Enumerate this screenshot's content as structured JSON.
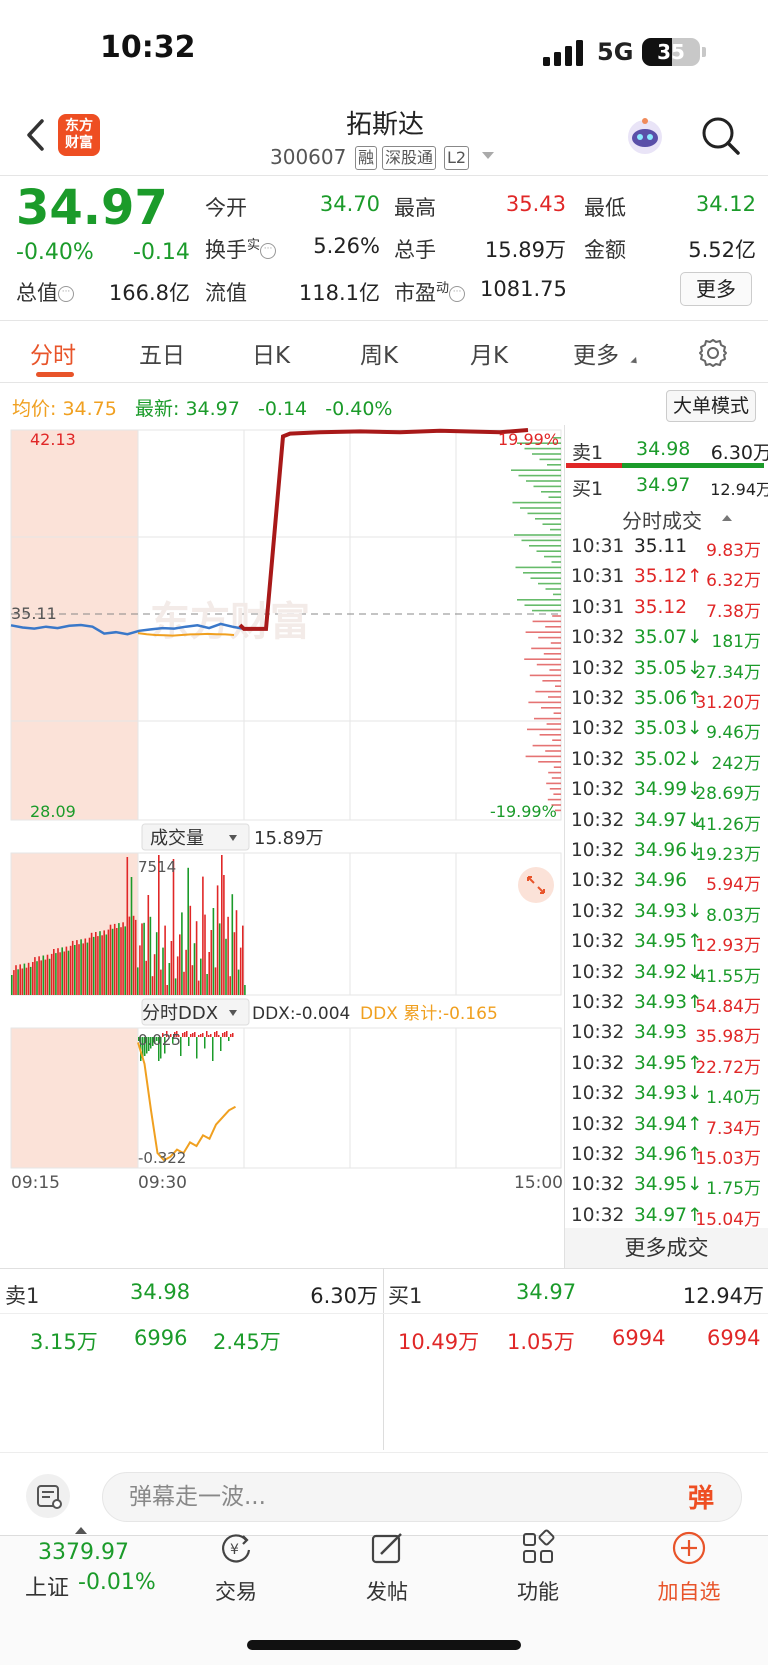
{
  "status_bar": {
    "time": "10:32",
    "network": "5G",
    "battery": "35"
  },
  "header": {
    "logo_line1": "东方",
    "logo_line2": "财富",
    "stock_name": "拓斯达",
    "stock_code": "300607",
    "tags": [
      "融",
      "深股通",
      "L2"
    ]
  },
  "quote": {
    "last_price": "34.97",
    "change_pct": "-0.40%",
    "change_abs": "-0.14",
    "open_label": "今开",
    "open": "34.70",
    "high_label": "最高",
    "high": "35.43",
    "low_label": "最低",
    "low": "34.12",
    "turnover_label": "换手",
    "turnover_sup": "实",
    "turnover": "5.26%",
    "volume_label": "总手",
    "volume": "15.89万",
    "amount_label": "金额",
    "amount": "5.52亿",
    "total_cap_label": "总值",
    "total_cap": "166.8亿",
    "float_cap_label": "流值",
    "float_cap": "118.1亿",
    "pe_label": "市盈",
    "pe_sup": "动",
    "pe": "1081.75",
    "more_label": "更多"
  },
  "tabs": [
    "分时",
    "五日",
    "日K",
    "周K",
    "月K",
    "更多"
  ],
  "chart_info": {
    "avg_label": "均价:",
    "avg_value": "34.75",
    "latest_label": "最新:",
    "latest_value": "34.97",
    "latest_chg": "-0.14",
    "latest_pct": "-0.40%",
    "big_order_label": "大单模式"
  },
  "chart_labels": {
    "price_top": "42.13",
    "price_bottom": "28.09",
    "price_ref": "35.11",
    "pct_top": "19.99%",
    "pct_bottom": "-19.99%",
    "watermark": "东方财富",
    "volume_selector": "成交量",
    "volume_total": "15.89万",
    "volume_max": "7514",
    "ddx_selector": "分时DDX",
    "ddx_value": "DDX:-0.004",
    "ddx_cum": "DDX 累计:-0.165",
    "ddx_top": "0.025",
    "ddx_bottom": "-0.322",
    "time_start": "09:15",
    "time_open": "09:30",
    "time_end": "15:00"
  },
  "chart_data": {
    "type": "line",
    "title": "",
    "price_axis": [
      28.09,
      42.13
    ],
    "reference_price": 35.11,
    "pct_axis": [
      "-19.99%",
      "19.99%"
    ],
    "x_ticks": [
      "09:15",
      "09:30",
      "15:00"
    ],
    "series": [
      {
        "name": "最新",
        "color": "#3a78c9",
        "values": [
          35.1,
          35.02,
          34.98,
          35.05,
          35.0,
          35.08,
          35.11,
          35.05,
          34.8,
          34.85,
          34.78,
          34.9,
          34.95,
          35.0,
          34.98,
          35.05,
          35.1,
          35.0,
          35.15,
          35.05,
          34.97
        ]
      },
      {
        "name": "均价",
        "color": "#f0a020",
        "values": [
          34.82,
          34.78,
          34.75,
          34.74,
          34.73,
          34.75,
          34.77,
          34.78,
          34.79,
          34.78,
          34.77,
          34.75
        ]
      },
      {
        "name": "",
        "color": "#a81919",
        "values": [
          35.11,
          34.97,
          34.97,
          41.9,
          42.0,
          42.05,
          42.08,
          42.05,
          42.1,
          42.05,
          42.13
        ]
      }
    ],
    "volume": {
      "max": 7514,
      "total": "15.89万"
    },
    "ddx": {
      "range": [
        -0.322,
        0.025
      ],
      "latest": -0.004,
      "cumulative": -0.165
    }
  },
  "order_book": {
    "sell1_label": "卖1",
    "sell1_price": "34.98",
    "sell1_vol": "6.30万",
    "buy1_label": "买1",
    "buy1_price": "34.97",
    "buy1_vol": "12.94万"
  },
  "trades_title": "分时成交",
  "trades": [
    {
      "time": "10:31",
      "price": "35.11",
      "price_color": "#222222",
      "arrow": "",
      "vol": "9.83万",
      "vol_color": "#e02727"
    },
    {
      "time": "10:31",
      "price": "35.12",
      "price_color": "#e02727",
      "arrow": "↑",
      "vol": "6.32万",
      "vol_color": "#e02727"
    },
    {
      "time": "10:31",
      "price": "35.12",
      "price_color": "#e02727",
      "arrow": "",
      "vol": "7.38万",
      "vol_color": "#e02727"
    },
    {
      "time": "10:32",
      "price": "35.07",
      "price_color": "#1b9b2a",
      "arrow": "↓",
      "vol": "181万",
      "vol_color": "#1b9b2a"
    },
    {
      "time": "10:32",
      "price": "35.05",
      "price_color": "#1b9b2a",
      "arrow": "↓",
      "vol": "27.34万",
      "vol_color": "#1b9b2a"
    },
    {
      "time": "10:32",
      "price": "35.06",
      "price_color": "#1b9b2a",
      "arrow": "↑",
      "vol": "31.20万",
      "vol_color": "#e02727"
    },
    {
      "time": "10:32",
      "price": "35.03",
      "price_color": "#1b9b2a",
      "arrow": "↓",
      "vol": "9.46万",
      "vol_color": "#1b9b2a"
    },
    {
      "time": "10:32",
      "price": "35.02",
      "price_color": "#1b9b2a",
      "arrow": "↓",
      "vol": "242万",
      "vol_color": "#1b9b2a"
    },
    {
      "time": "10:32",
      "price": "34.99",
      "price_color": "#1b9b2a",
      "arrow": "↓",
      "vol": "28.69万",
      "vol_color": "#1b9b2a"
    },
    {
      "time": "10:32",
      "price": "34.97",
      "price_color": "#1b9b2a",
      "arrow": "↓",
      "vol": "41.26万",
      "vol_color": "#1b9b2a"
    },
    {
      "time": "10:32",
      "price": "34.96",
      "price_color": "#1b9b2a",
      "arrow": "↓",
      "vol": "19.23万",
      "vol_color": "#1b9b2a"
    },
    {
      "time": "10:32",
      "price": "34.96",
      "price_color": "#1b9b2a",
      "arrow": "",
      "vol": "5.94万",
      "vol_color": "#e02727"
    },
    {
      "time": "10:32",
      "price": "34.93",
      "price_color": "#1b9b2a",
      "arrow": "↓",
      "vol": "8.03万",
      "vol_color": "#1b9b2a"
    },
    {
      "time": "10:32",
      "price": "34.95",
      "price_color": "#1b9b2a",
      "arrow": "↑",
      "vol": "12.93万",
      "vol_color": "#e02727"
    },
    {
      "time": "10:32",
      "price": "34.92",
      "price_color": "#1b9b2a",
      "arrow": "↓",
      "vol": "41.55万",
      "vol_color": "#1b9b2a"
    },
    {
      "time": "10:32",
      "price": "34.93",
      "price_color": "#1b9b2a",
      "arrow": "↑",
      "vol": "54.84万",
      "vol_color": "#e02727"
    },
    {
      "time": "10:32",
      "price": "34.93",
      "price_color": "#1b9b2a",
      "arrow": "",
      "vol": "35.98万",
      "vol_color": "#e02727"
    },
    {
      "time": "10:32",
      "price": "34.95",
      "price_color": "#1b9b2a",
      "arrow": "↑",
      "vol": "22.72万",
      "vol_color": "#e02727"
    },
    {
      "time": "10:32",
      "price": "34.93",
      "price_color": "#1b9b2a",
      "arrow": "↓",
      "vol": "1.40万",
      "vol_color": "#1b9b2a"
    },
    {
      "time": "10:32",
      "price": "34.94",
      "price_color": "#1b9b2a",
      "arrow": "↑",
      "vol": "7.34万",
      "vol_color": "#e02727"
    },
    {
      "time": "10:32",
      "price": "34.96",
      "price_color": "#1b9b2a",
      "arrow": "↑",
      "vol": "15.03万",
      "vol_color": "#e02727"
    },
    {
      "time": "10:32",
      "price": "34.95",
      "price_color": "#1b9b2a",
      "arrow": "↓",
      "vol": "1.75万",
      "vol_color": "#1b9b2a"
    },
    {
      "time": "10:32",
      "price": "34.97",
      "price_color": "#1b9b2a",
      "arrow": "↑",
      "vol": "15.04万",
      "vol_color": "#e02727"
    }
  ],
  "more_trades": "更多成交",
  "bottom_book": {
    "sell_label": "卖1",
    "sell_price": "34.98",
    "sell_vol": "6.30万",
    "buy_label": "买1",
    "buy_price": "34.97",
    "buy_vol": "12.94万",
    "sell_detail": [
      "3.15万",
      "6996",
      "2.45万"
    ],
    "buy_detail": [
      "10.49万",
      "1.05万",
      "6994",
      "6994"
    ]
  },
  "comment": {
    "placeholder": "弹幕走一波...",
    "danmu_btn": "弹"
  },
  "bottom_nav": {
    "index_value": "3379.97",
    "index_name": "上证",
    "index_change": "-0.01%",
    "items": [
      {
        "label": "交易",
        "icon": "trade-icon"
      },
      {
        "label": "发帖",
        "icon": "post-icon"
      },
      {
        "label": "功能",
        "icon": "function-icon"
      },
      {
        "label": "加自选",
        "icon": "add-watchlist-icon"
      }
    ]
  },
  "colors": {
    "up": "#e02727",
    "down": "#1b9b2a",
    "accent": "#e8542a",
    "avg": "#f0a020",
    "price_line": "#3a78c9"
  }
}
